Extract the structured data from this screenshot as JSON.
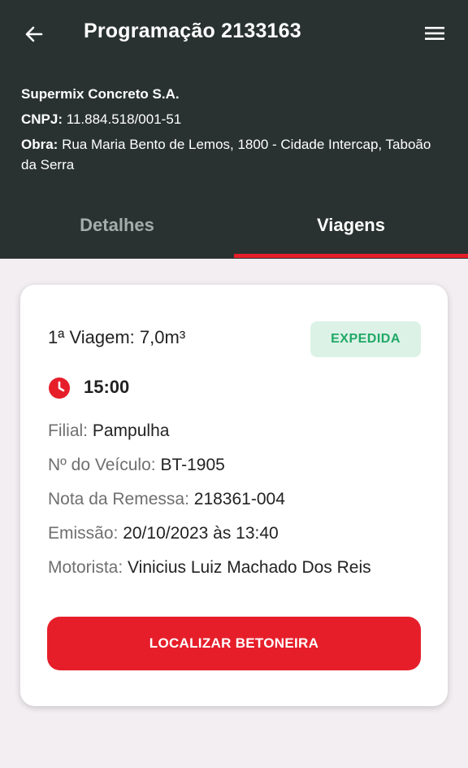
{
  "header": {
    "title": "Programação 2133163",
    "company": "Supermix Concreto S.A.",
    "cnpj_label": "CNPJ:",
    "cnpj_value": "11.884.518/001-51",
    "obra_label": "Obra:",
    "obra_value": "Rua Maria Bento de Lemos, 1800 - Cidade Intercap, Taboão da Serra",
    "background_color": "#293230"
  },
  "tabs": [
    {
      "label": "Detalhes",
      "active": false
    },
    {
      "label": "Viagens",
      "active": true
    }
  ],
  "trip": {
    "title": "1ª Viagem: 7,0m³",
    "status": "EXPEDIDA",
    "status_color": "#20a866",
    "time": "15:00",
    "fields": [
      {
        "label": "Filial:",
        "value": "Pampulha"
      },
      {
        "label": "Nº do Veículo:",
        "value": "BT-1905"
      },
      {
        "label": "Nota da Remessa:",
        "value": "218361-004"
      },
      {
        "label": "Emissão:",
        "value": "20/10/2023 às 13:40"
      },
      {
        "label": "Motorista:",
        "value": "Vinicius Luiz Machado Dos Reis"
      }
    ],
    "button_label": "LOCALIZAR BETONEIRA"
  },
  "accent_color": "#e61e2a",
  "icons": {
    "back": "arrow-left-icon",
    "menu": "hamburger-menu-icon",
    "clock": "clock-icon"
  }
}
